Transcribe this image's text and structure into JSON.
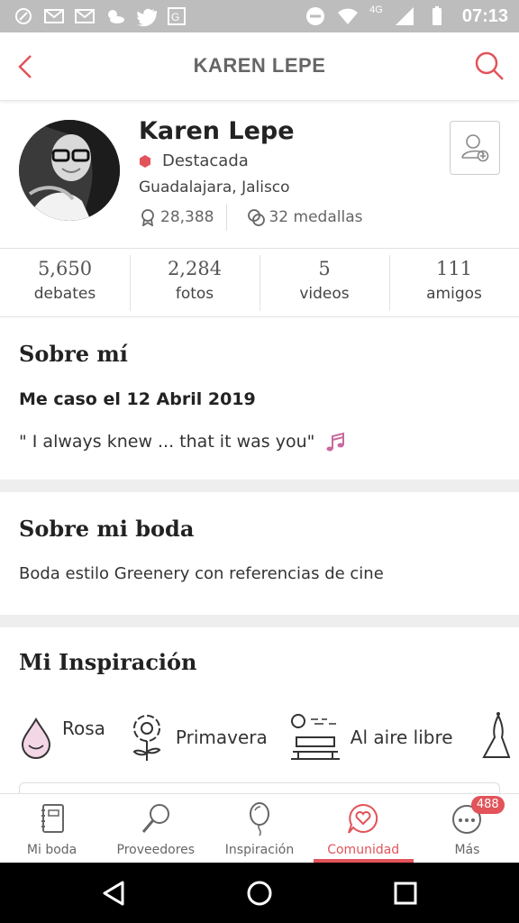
{
  "status_bar": {
    "time": "07:13",
    "network": "4G",
    "icons": [
      "signal-app-icon",
      "gmail-icon",
      "gmail-icon",
      "weather-icon",
      "twitter-icon",
      "maps-icon",
      "do-not-disturb-icon",
      "wifi-icon",
      "cell-signal-icon",
      "battery-icon"
    ]
  },
  "header": {
    "title": "KAREN LEPE",
    "accent": "#e2535a"
  },
  "profile": {
    "name": "Karen Lepe",
    "badge": "Destacada",
    "location": "Guadalajara, Jalisco",
    "points": "28,388",
    "medals": "32 medallas"
  },
  "counters": [
    {
      "value": "5,650",
      "label": "debates"
    },
    {
      "value": "2,284",
      "label": "fotos"
    },
    {
      "value": "5",
      "label": "videos"
    },
    {
      "value": "111",
      "label": "amigos"
    }
  ],
  "about": {
    "title": "Sobre mí",
    "wedding_date": "Me caso el 12 Abril 2019",
    "quote": "\" I always knew ... that it was you\""
  },
  "wedding": {
    "title": "Sobre mi boda",
    "description": "Boda estilo Greenery con referencias de cine"
  },
  "inspiration": {
    "title": "Mi Inspiración",
    "items": [
      {
        "label": "Rosa",
        "icon": "drop-icon"
      },
      {
        "label": "Primavera",
        "icon": "flower-icon"
      },
      {
        "label": "Al aire libre",
        "icon": "park-bench-icon"
      },
      {
        "label": "",
        "icon": "dress-icon"
      }
    ]
  },
  "bottom_nav": [
    {
      "label": "Mi boda",
      "icon": "notebook-icon"
    },
    {
      "label": "Proveedores",
      "icon": "magnifier-icon"
    },
    {
      "label": "Inspiración",
      "icon": "balloon-icon"
    },
    {
      "label": "Comunidad",
      "icon": "heart-chat-icon",
      "active": true
    },
    {
      "label": "Más",
      "icon": "more-icon",
      "badge": "488"
    }
  ]
}
